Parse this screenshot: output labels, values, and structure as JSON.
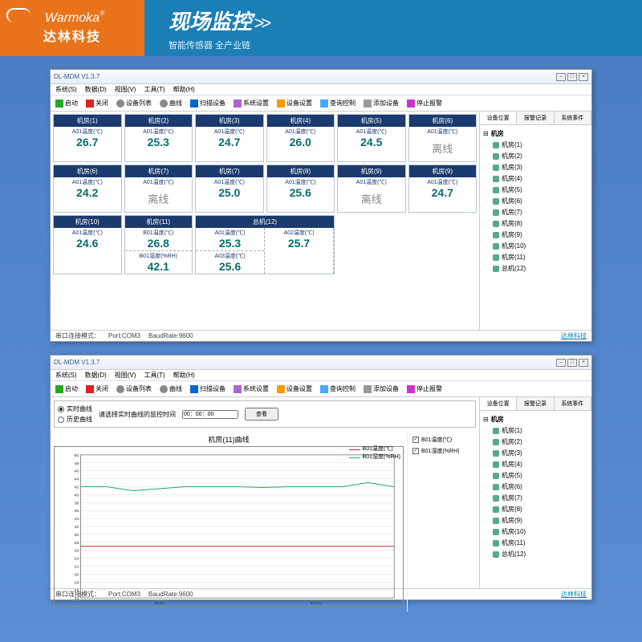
{
  "header": {
    "brand_en": "Warmoka",
    "brand_cn": "达林科技",
    "title": "现场监控",
    "arrow": ">>",
    "subtitle": "智能传感器 全产业链"
  },
  "app": {
    "title": "DL-MDM V1.3.7",
    "menus": [
      "系统(S)",
      "数据(D)",
      "视图(V)",
      "工具(T)",
      "帮助(H)"
    ],
    "tools": [
      {
        "k": "play",
        "t": "启动"
      },
      {
        "k": "stop",
        "t": "关闭"
      },
      {
        "k": "gear",
        "t": "设备列表"
      },
      {
        "k": "curve",
        "t": "曲线"
      },
      {
        "k": "scan",
        "t": "扫描设备"
      },
      {
        "k": "sys",
        "t": "系统设置"
      },
      {
        "k": "dev",
        "t": "设备设置"
      },
      {
        "k": "ctrl",
        "t": "查询控制"
      },
      {
        "k": "add",
        "t": "添加设备"
      },
      {
        "k": "alert",
        "t": "停止报警"
      }
    ],
    "side_tabs": [
      "设备位置",
      "报警记录",
      "系统事件"
    ],
    "tree_root": "机房",
    "tree": [
      "机房(1)",
      "机房(2)",
      "机房(3)",
      "机房(4)",
      "机房(5)",
      "机房(6)",
      "机房(7)",
      "机房(8)",
      "机房(9)",
      "机房(10)",
      "机房(11)",
      "总机(12)"
    ],
    "status": {
      "mode": "串口连接模式：",
      "port": "Port:COM3",
      "baud": "BaudRate:9600",
      "brand": "达林科技"
    }
  },
  "cells": [
    {
      "name": "机房(1)",
      "metrics": [
        {
          "l": "A01温度(℃)",
          "v": "26.7"
        }
      ]
    },
    {
      "name": "机房(2)",
      "metrics": [
        {
          "l": "A01温度(℃)",
          "v": "25.3"
        }
      ]
    },
    {
      "name": "机房(3)",
      "metrics": [
        {
          "l": "A01温度(℃)",
          "v": "24.7"
        }
      ]
    },
    {
      "name": "机房(4)",
      "metrics": [
        {
          "l": "A01温度(℃)",
          "v": "26.0"
        }
      ]
    },
    {
      "name": "机房(5)",
      "metrics": [
        {
          "l": "A01温度(℃)",
          "v": "24.5"
        }
      ]
    },
    {
      "name": "机房(6)",
      "offline": "离线",
      "metrics": [
        {
          "l": "A01温度(℃)"
        }
      ]
    },
    {
      "name": "机房(6)",
      "metrics": [
        {
          "l": "A01温度(℃)",
          "v": "24.2"
        }
      ]
    },
    {
      "name": "机房(7)",
      "offline": "离线",
      "metrics": [
        {
          "l": "A01温度(℃)"
        }
      ]
    },
    {
      "name": "机房(7)",
      "metrics": [
        {
          "l": "A01温度(℃)",
          "v": "25.0"
        }
      ]
    },
    {
      "name": "机房(8)",
      "metrics": [
        {
          "l": "A01温度(℃)",
          "v": "25.6"
        }
      ]
    },
    {
      "name": "机房(9)",
      "offline": "离线",
      "metrics": [
        {
          "l": "A01温度(℃)"
        }
      ]
    },
    {
      "name": "机房(9)",
      "metrics": [
        {
          "l": "A01温度(℃)",
          "v": "24.7"
        }
      ]
    },
    {
      "name": "机房(10)",
      "metrics": [
        {
          "l": "A01温度(℃)",
          "v": "24.6"
        }
      ]
    },
    {
      "name": "机房(11)",
      "metrics": [
        {
          "l": "B01温度(℃)",
          "v": "26.8"
        },
        {
          "l": "B01湿度(%RH)",
          "v": "42.1"
        }
      ]
    },
    {
      "name": "总机(12)",
      "span": 2,
      "metrics2": [
        [
          {
            "l": "A01温度(℃)",
            "v": "25.3"
          },
          {
            "l": "A03温度(℃)",
            "v": "25.6"
          }
        ],
        [
          {
            "l": "A02温度(℃)",
            "v": "25.7"
          }
        ]
      ]
    }
  ],
  "query": {
    "title": "请选择实时曲线的监控时间",
    "opt1": "实时曲线",
    "opt2": "历史曲线",
    "time": "00：00：00",
    "btn": "查看"
  },
  "chart_data": {
    "type": "line",
    "title": "机房(11)曲线",
    "series": [
      {
        "name": "B01温度(℃)",
        "color": "#c23",
        "values": [
          27,
          27,
          27,
          27,
          27,
          27,
          27,
          27,
          27,
          27,
          27,
          27,
          27
        ]
      },
      {
        "name": "B01湿度(%RH)",
        "color": "#2a6",
        "values": [
          42,
          42,
          41,
          41.5,
          42,
          42,
          42,
          41.8,
          42,
          42,
          42,
          43,
          42
        ]
      }
    ],
    "x_ticks": [
      "10:50",
      "10:51"
    ],
    "ylim": [
      14,
      50
    ],
    "y_ticks": [
      14,
      16,
      18,
      20,
      22,
      24,
      26,
      28,
      30,
      32,
      34,
      36,
      38,
      40,
      42,
      44,
      46,
      48,
      50
    ],
    "checks": [
      {
        "l": "B01温度(℃)",
        "on": true
      },
      {
        "l": "B01湿度(%RH)",
        "on": true
      }
    ]
  }
}
